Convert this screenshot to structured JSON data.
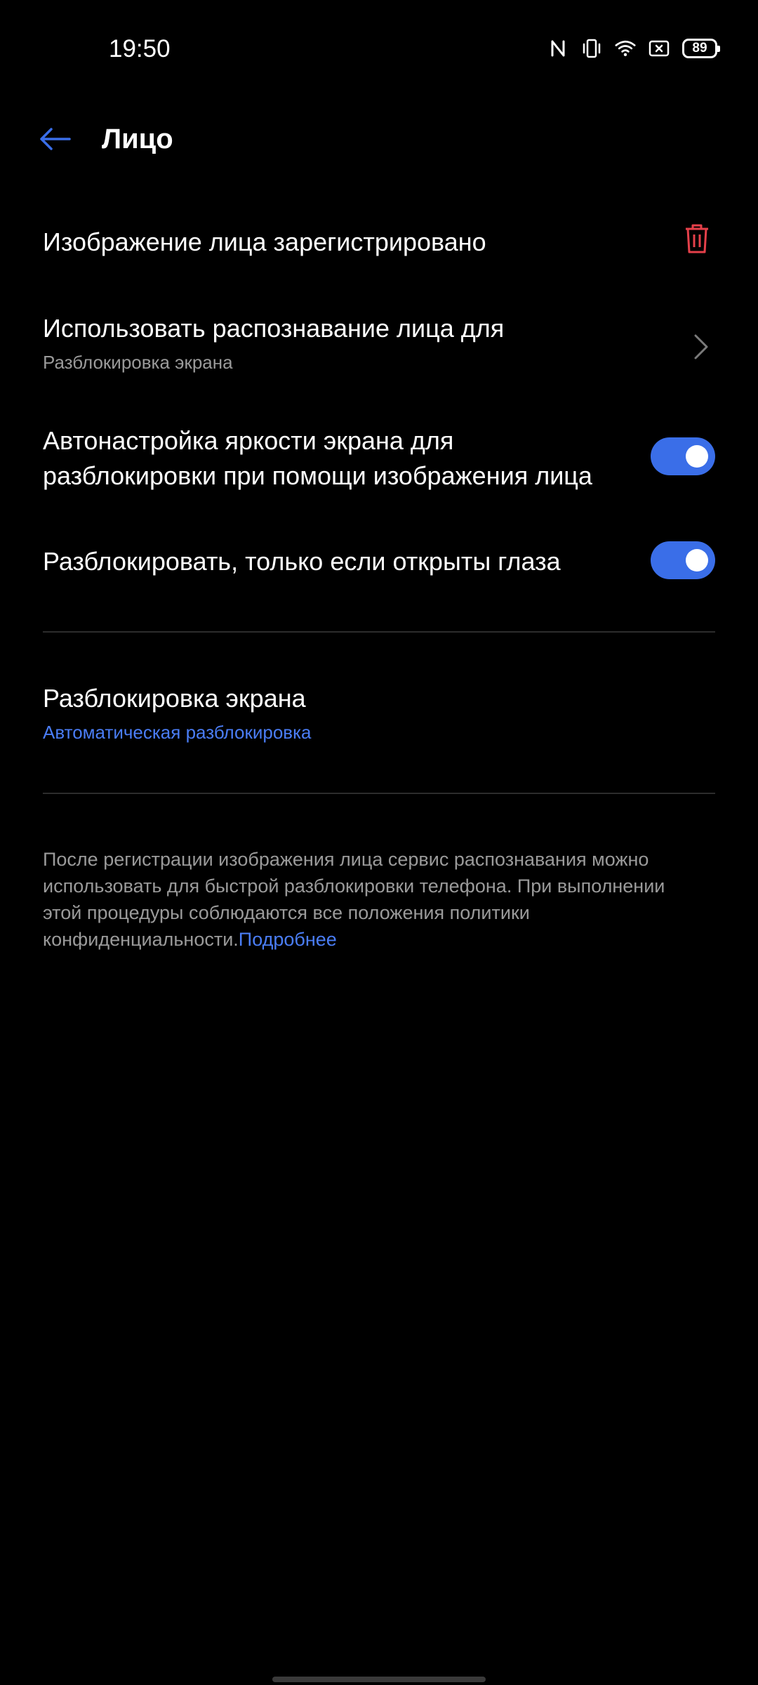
{
  "status_bar": {
    "time": "19:50",
    "icons": [
      "nfc-icon",
      "vibrate-icon",
      "wifi-icon",
      "sim-icon"
    ],
    "battery": "89"
  },
  "header": {
    "title": "Лицо",
    "back_icon": "arrow-left-icon"
  },
  "items": {
    "registered": {
      "title": "Изображение лица зарегистрировано",
      "icon": "trash-icon"
    },
    "use_for": {
      "title": "Использовать распознавание лица для",
      "subtitle": "Разблокировка экрана",
      "icon": "chevron-right-icon"
    },
    "auto_brightness": {
      "title_line1": "Автонастройка яркости экрана для",
      "title_line2": "разблокировки при помощи изображения лица",
      "enabled": true
    },
    "eyes_open": {
      "title": "Разблокировать, только если открыты глаза",
      "enabled": true
    },
    "screen_unlock": {
      "title": "Разблокировка экрана",
      "subtitle": "Автоматическая разблокировка"
    }
  },
  "info": {
    "text": "После регистрации изображения лица сервис распознавания можно использовать для быстрой разблокировки телефона. При выполнении этой процедуры соблюдаются все положения политики конфиденциальности.",
    "link": "Подробнее"
  },
  "colors": {
    "accent": "#3a6ee8",
    "link": "#4a7df5",
    "danger": "#e5404a",
    "background": "#000000",
    "secondary_text": "#9a9a9a"
  }
}
